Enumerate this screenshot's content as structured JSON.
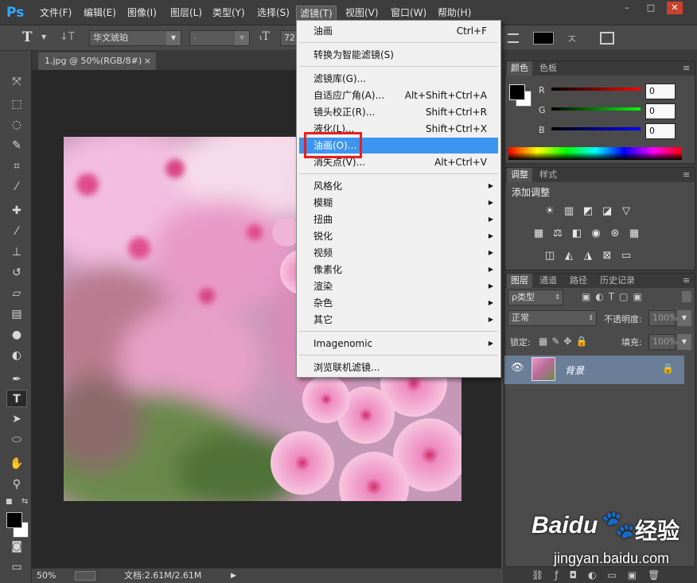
{
  "app": {
    "logo": "Ps"
  },
  "menu": [
    "文件(F)",
    "编辑(E)",
    "图像(I)",
    "图层(L)",
    "类型(Y)",
    "选择(S)",
    "滤镜(T)",
    "视图(V)",
    "窗口(W)",
    "帮助(H)"
  ],
  "window_controls": [
    "–",
    "□",
    "✕"
  ],
  "options": {
    "tool_glyph": "T",
    "font_family": "华文琥珀",
    "font_style": "-",
    "font_size": "72"
  },
  "document": {
    "tab": "1.jpg @ 50%(RGB/8#)",
    "close": "×"
  },
  "status": {
    "zoom": "50%",
    "doc": "文档:2.61M/2.61M"
  },
  "filter_menu": {
    "group1": [
      {
        "label": "油画",
        "shortcut": "Ctrl+F"
      }
    ],
    "group2": [
      {
        "label": "转换为智能滤镜(S)",
        "shortcut": ""
      }
    ],
    "group3": [
      {
        "label": "滤镜库(G)...",
        "shortcut": ""
      },
      {
        "label": "自适应广角(A)...",
        "shortcut": "Alt+Shift+Ctrl+A"
      },
      {
        "label": "镜头校正(R)...",
        "shortcut": "Shift+Ctrl+R"
      },
      {
        "label": "液化(L)...",
        "shortcut": "Shift+Ctrl+X"
      },
      {
        "label": "油画(O)...",
        "shortcut": "",
        "highlighted": true
      },
      {
        "label": "消失点(V)...",
        "shortcut": "Alt+Ctrl+V"
      }
    ],
    "group4": [
      "风格化",
      "模糊",
      "扭曲",
      "锐化",
      "视频",
      "像素化",
      "渲染",
      "杂色",
      "其它"
    ],
    "group5": [
      "Imagenomic"
    ],
    "group6": [
      "浏览联机滤镜..."
    ]
  },
  "color_panel": {
    "tabs": [
      "颜色",
      "色板"
    ],
    "channels": [
      {
        "label": "R",
        "value": "0"
      },
      {
        "label": "G",
        "value": "0"
      },
      {
        "label": "B",
        "value": "0"
      }
    ]
  },
  "adjustments_panel": {
    "tabs": [
      "调整",
      "样式"
    ],
    "title": "添加调整"
  },
  "layers_panel": {
    "tabs": [
      "图层",
      "通道",
      "路径",
      "历史记录"
    ],
    "filter_kind": "ρ类型",
    "blend_mode": "正常",
    "opacity_label": "不透明度:",
    "opacity_value": "100%",
    "lock_label": "锁定:",
    "fill_label": "填充:",
    "fill_value": "100%",
    "layer_name": "背景"
  },
  "watermark": {
    "brand": "Baidu",
    "sub": "经验",
    "url": "jingyan.baidu.com"
  },
  "colors": {
    "highlight": "#3c96ef",
    "redbox": "#e8201c",
    "layer_selected": "#6a7e98"
  }
}
